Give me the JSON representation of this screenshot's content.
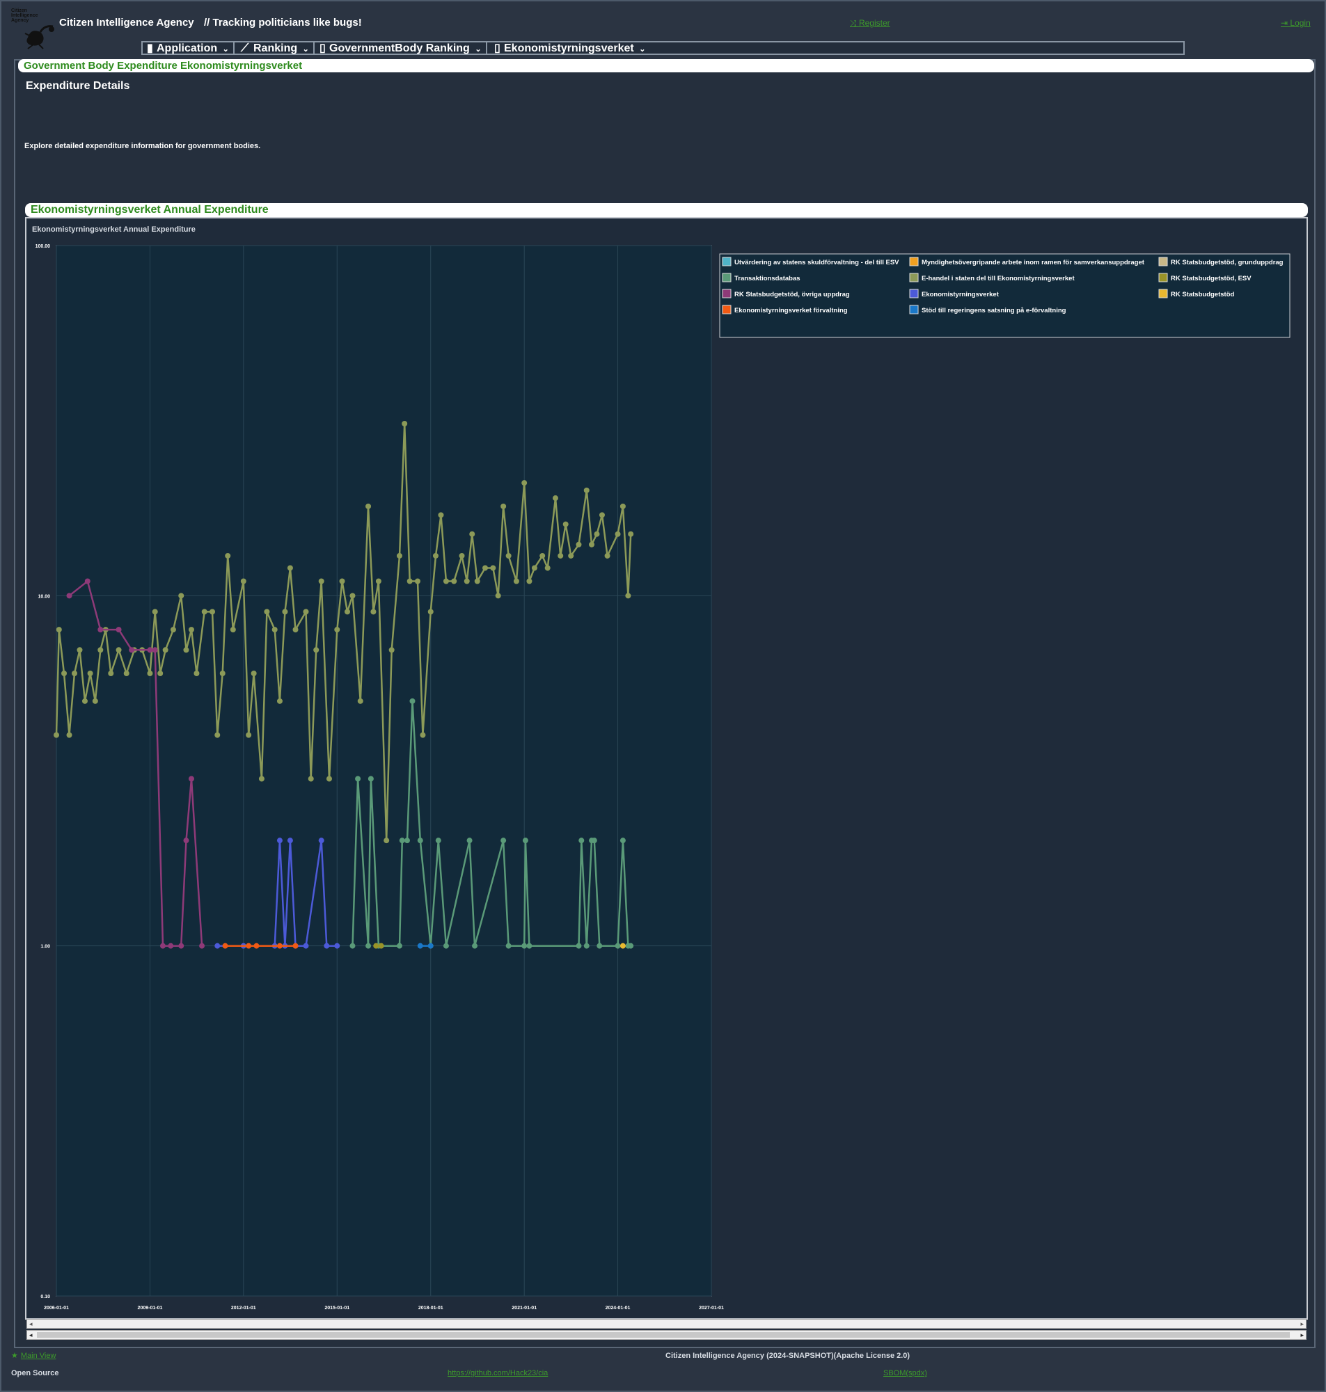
{
  "header": {
    "app_name": "Citizen Intelligence Agency",
    "tagline": "// Tracking politicians like bugs!",
    "logo_text": "Citizen Intelligence Agency",
    "register_label": "Register",
    "login_label": "Login"
  },
  "menu": [
    {
      "label": "Application",
      "icon": "server-icon"
    },
    {
      "label": "Ranking",
      "icon": "line-chart-icon"
    },
    {
      "label": "GovernmentBody Ranking",
      "icon": "building-icon"
    },
    {
      "label": "Ekonomistyrningsverket",
      "icon": "building-icon"
    }
  ],
  "page": {
    "heading": "Government Body Expenditure Ekonomistyrningsverket",
    "section_title": "Expenditure Details",
    "description": "Explore detailed expenditure information for government bodies."
  },
  "chart_section": {
    "heading": "Ekonomistyrningsverket Annual Expenditure"
  },
  "chart_data": {
    "type": "line",
    "title": "Ekonomistyrningsverket Annual Expenditure",
    "yscale": "log",
    "ylim": [
      0.1,
      100
    ],
    "y_ticks": [
      "100.00",
      "10.00",
      "1.00",
      "0.10"
    ],
    "x_ticks": [
      "2006-01-01",
      "2009-01-01",
      "2012-01-01",
      "2015-01-01",
      "2018-01-01",
      "2021-01-01",
      "2024-01-01",
      "2027-01-01"
    ],
    "xlim": [
      "2006-01-01",
      "2027-01-01"
    ],
    "grid": true,
    "legend_position": "right",
    "series": [
      {
        "name": "Utvärdering av statens skuldförvaltning - del till ESV",
        "color": "#4fb3c8",
        "points": []
      },
      {
        "name": "Myndighetsövergripande arbete inom ramen för samverkansuppdraget",
        "color": "#f0a020",
        "points": []
      },
      {
        "name": "RK Statsbudgetstöd, grunduppdrag",
        "color": "#c8b888",
        "points": []
      },
      {
        "name": "Transaktionsdatabas",
        "color": "#5a9a78",
        "points": [
          [
            "2015-07-01",
            1
          ],
          [
            "2015-09-01",
            3
          ],
          [
            "2016-01-01",
            1
          ],
          [
            "2016-02-01",
            3
          ],
          [
            "2016-05-01",
            1
          ],
          [
            "2017-01-01",
            1
          ],
          [
            "2017-02-01",
            2
          ],
          [
            "2017-04-01",
            2
          ],
          [
            "2017-06-01",
            5
          ],
          [
            "2017-09-01",
            2
          ],
          [
            "2018-01-01",
            1
          ],
          [
            "2018-04-01",
            2
          ],
          [
            "2018-07-01",
            1
          ],
          [
            "2019-04-01",
            2
          ],
          [
            "2019-06-01",
            1
          ],
          [
            "2020-05-01",
            2
          ],
          [
            "2020-07-01",
            1
          ],
          [
            "2021-01-01",
            1
          ],
          [
            "2021-01-15",
            2
          ],
          [
            "2021-03-01",
            1
          ],
          [
            "2022-10-01",
            1
          ],
          [
            "2022-11-01",
            2
          ],
          [
            "2023-01-01",
            1
          ],
          [
            "2023-03-01",
            2
          ],
          [
            "2023-04-01",
            2
          ],
          [
            "2023-06-01",
            1
          ],
          [
            "2024-01-01",
            1
          ],
          [
            "2024-03-01",
            2
          ],
          [
            "2024-05-01",
            1
          ],
          [
            "2024-06-01",
            1
          ]
        ]
      },
      {
        "name": "E-handel i staten del till Ekonomistyrningsverket",
        "color": "#8c9a58",
        "points": [
          [
            "2006-01-01",
            4
          ],
          [
            "2006-02-01",
            8
          ],
          [
            "2006-04-01",
            6
          ],
          [
            "2006-06-01",
            4
          ],
          [
            "2006-08-01",
            6
          ],
          [
            "2006-10-01",
            7
          ],
          [
            "2006-12-01",
            5
          ],
          [
            "2007-02-01",
            6
          ],
          [
            "2007-04-01",
            5
          ],
          [
            "2007-06-01",
            7
          ],
          [
            "2007-08-01",
            8
          ],
          [
            "2007-10-01",
            6
          ],
          [
            "2008-01-01",
            7
          ],
          [
            "2008-04-01",
            6
          ],
          [
            "2008-07-01",
            7
          ],
          [
            "2008-10-01",
            7
          ],
          [
            "2009-01-01",
            6
          ],
          [
            "2009-03-01",
            9
          ],
          [
            "2009-05-01",
            6
          ],
          [
            "2009-07-01",
            7
          ],
          [
            "2009-10-01",
            8
          ],
          [
            "2010-01-01",
            10
          ],
          [
            "2010-03-01",
            7
          ],
          [
            "2010-05-01",
            8
          ],
          [
            "2010-07-01",
            6
          ],
          [
            "2010-10-01",
            9
          ],
          [
            "2011-01-01",
            9
          ],
          [
            "2011-03-01",
            4
          ],
          [
            "2011-05-01",
            6
          ],
          [
            "2011-07-01",
            13
          ],
          [
            "2011-09-01",
            8
          ],
          [
            "2012-01-01",
            11
          ],
          [
            "2012-03-01",
            4
          ],
          [
            "2012-05-01",
            6
          ],
          [
            "2012-08-01",
            3
          ],
          [
            "2012-10-01",
            9
          ],
          [
            "2013-01-01",
            8
          ],
          [
            "2013-03-01",
            5
          ],
          [
            "2013-05-01",
            9
          ],
          [
            "2013-07-01",
            12
          ],
          [
            "2013-09-01",
            8
          ],
          [
            "2014-01-01",
            9
          ],
          [
            "2014-03-01",
            3
          ],
          [
            "2014-05-01",
            7
          ],
          [
            "2014-07-01",
            11
          ],
          [
            "2014-10-01",
            3
          ],
          [
            "2015-01-01",
            8
          ],
          [
            "2015-03-01",
            11
          ],
          [
            "2015-05-01",
            9
          ],
          [
            "2015-07-01",
            10
          ],
          [
            "2015-10-01",
            5
          ],
          [
            "2016-01-01",
            18
          ],
          [
            "2016-03-01",
            9
          ],
          [
            "2016-05-01",
            11
          ],
          [
            "2016-08-01",
            2
          ],
          [
            "2016-10-01",
            7
          ],
          [
            "2017-01-01",
            13
          ],
          [
            "2017-03-01",
            31
          ],
          [
            "2017-05-01",
            11
          ],
          [
            "2017-08-01",
            11
          ],
          [
            "2017-10-01",
            4
          ],
          [
            "2018-01-01",
            9
          ],
          [
            "2018-03-01",
            13
          ],
          [
            "2018-05-01",
            17
          ],
          [
            "2018-07-01",
            11
          ],
          [
            "2018-10-01",
            11
          ],
          [
            "2019-01-01",
            13
          ],
          [
            "2019-03-01",
            11
          ],
          [
            "2019-05-01",
            15
          ],
          [
            "2019-07-01",
            11
          ],
          [
            "2019-10-01",
            12
          ],
          [
            "2020-01-01",
            12
          ],
          [
            "2020-03-01",
            10
          ],
          [
            "2020-05-01",
            18
          ],
          [
            "2020-07-01",
            13
          ],
          [
            "2020-10-01",
            11
          ],
          [
            "2021-01-01",
            21
          ],
          [
            "2021-03-01",
            11
          ],
          [
            "2021-05-01",
            12
          ],
          [
            "2021-08-01",
            13
          ],
          [
            "2021-10-01",
            12
          ],
          [
            "2022-01-01",
            19
          ],
          [
            "2022-03-01",
            13
          ],
          [
            "2022-05-01",
            16
          ],
          [
            "2022-07-01",
            13
          ],
          [
            "2022-10-01",
            14
          ],
          [
            "2023-01-01",
            20
          ],
          [
            "2023-03-01",
            14
          ],
          [
            "2023-05-01",
            15
          ],
          [
            "2023-07-01",
            17
          ],
          [
            "2023-09-01",
            13
          ],
          [
            "2024-01-01",
            15
          ],
          [
            "2024-03-01",
            18
          ],
          [
            "2024-05-01",
            10
          ],
          [
            "2024-06-01",
            15
          ]
        ]
      },
      {
        "name": "RK Statsbudgetstöd, ESV",
        "color": "#9a9428",
        "points": [
          [
            "2016-04-01",
            1
          ],
          [
            "2016-06-01",
            1
          ]
        ]
      },
      {
        "name": "RK Statsbudgetstöd, övriga uppdrag",
        "color": "#8e3a78",
        "points": [
          [
            "2006-06-01",
            10
          ],
          [
            "2007-01-01",
            11
          ],
          [
            "2007-06-01",
            8
          ],
          [
            "2008-01-01",
            8
          ],
          [
            "2008-06-01",
            7
          ],
          [
            "2009-01-01",
            7
          ],
          [
            "2009-03-01",
            7
          ],
          [
            "2009-06-01",
            1
          ],
          [
            "2009-09-01",
            1
          ],
          [
            "2010-01-01",
            1
          ],
          [
            "2010-03-01",
            2
          ],
          [
            "2010-05-01",
            3
          ],
          [
            "2010-09-01",
            1
          ]
        ]
      },
      {
        "name": "Ekonomistyrningsverket",
        "color": "#4c5ad8",
        "points": [
          [
            "2011-03-01",
            1
          ],
          [
            "2012-01-01",
            1
          ],
          [
            "2013-01-01",
            1
          ],
          [
            "2013-03-01",
            2
          ],
          [
            "2013-05-01",
            1
          ],
          [
            "2013-07-01",
            2
          ],
          [
            "2013-09-01",
            1
          ],
          [
            "2014-01-01",
            1
          ],
          [
            "2014-07-01",
            2
          ],
          [
            "2014-09-01",
            1
          ],
          [
            "2015-01-01",
            1
          ]
        ]
      },
      {
        "name": "RK Statsbudgetstöd",
        "color": "#e8b830",
        "points": [
          [
            "2024-03-01",
            1
          ]
        ]
      },
      {
        "name": "Ekonomistyrningsverket förvaltning",
        "color": "#f05a14",
        "points": [
          [
            "2011-06-01",
            1
          ],
          [
            "2012-03-01",
            1
          ],
          [
            "2012-06-01",
            1
          ],
          [
            "2013-03-01",
            1
          ],
          [
            "2013-09-01",
            1
          ]
        ]
      },
      {
        "name": "Stöd till regeringens satsning på e-förvaltning",
        "color": "#1a78c8",
        "points": [
          [
            "2017-09-01",
            1
          ],
          [
            "2018-01-01",
            1
          ]
        ]
      }
    ]
  },
  "footer": {
    "main_view": "Main View",
    "license": "Citizen Intelligence Agency (2024-SNAPSHOT)(Apache License 2.0)",
    "open_source": "Open Source",
    "github": "https://github.com/Hack23/cia",
    "sbom": "SBOM(spdx)"
  }
}
